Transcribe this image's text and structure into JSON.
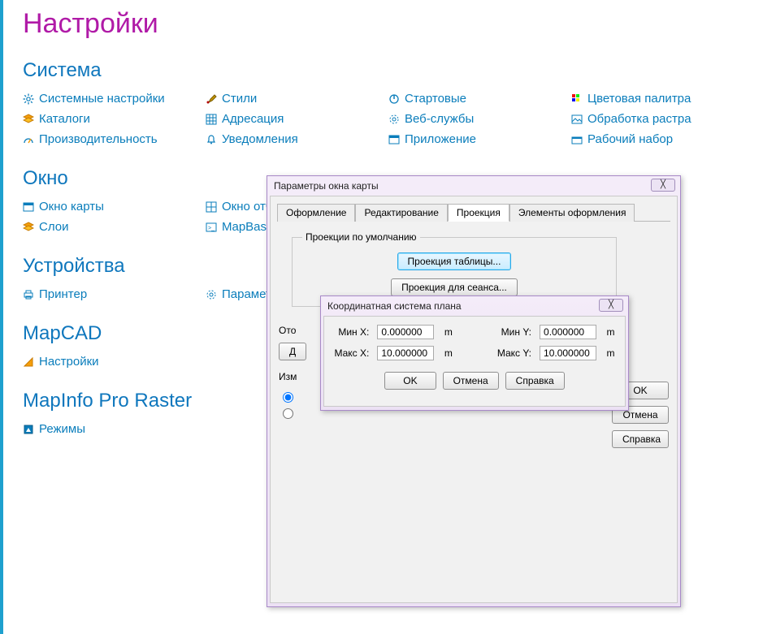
{
  "page_title": "Настройки",
  "sections": {
    "system": {
      "title": "Система",
      "cols": [
        [
          "Системные настройки",
          "Каталоги",
          "Производительность"
        ],
        [
          "Стили",
          "Адресация",
          "Уведомления"
        ],
        [
          "Стартовые",
          "Веб-службы",
          "Приложение"
        ],
        [
          "Цветовая палитра",
          "Обработка растра",
          "Рабочий набор"
        ]
      ]
    },
    "window": {
      "title": "Окно",
      "cols": [
        [
          "Окно карты",
          "Слои"
        ],
        [
          "Окно отчета",
          "MapBasic"
        ]
      ]
    },
    "devices": {
      "title": "Устройства",
      "cols": [
        [
          "Принтер"
        ],
        [
          "Параметры"
        ]
      ]
    },
    "mapcad": {
      "title": "MapCAD",
      "cols": [
        [
          "Настройки"
        ]
      ]
    },
    "raster": {
      "title": "MapInfo Pro Raster",
      "cols": [
        [
          "Режимы"
        ]
      ]
    }
  },
  "dialog1": {
    "title": "Параметры окна карты",
    "tabs": [
      "Оформление",
      "Редактирование",
      "Проекция",
      "Элементы оформления"
    ],
    "active_tab": 2,
    "fs_legend": "Проекции по умолчанию",
    "btn_proj_table": "Проекция таблицы...",
    "btn_proj_session": "Проекция для сеанса...",
    "left_label1": "Ото",
    "left_label2": "Д",
    "left_label3": "Изм",
    "ok": "OK",
    "cancel": "Отмена",
    "help": "Справка"
  },
  "dialog2": {
    "title": "Координатная система плана",
    "minx_lbl": "Мин X:",
    "miny_lbl": "Мин Y:",
    "maxx_lbl": "Макс X:",
    "maxy_lbl": "Макс Y:",
    "minx": "0.000000",
    "miny": "0.000000",
    "maxx": "10.000000",
    "maxy": "10.000000",
    "unit": "m",
    "ok": "OK",
    "cancel": "Отмена",
    "help": "Справка"
  }
}
